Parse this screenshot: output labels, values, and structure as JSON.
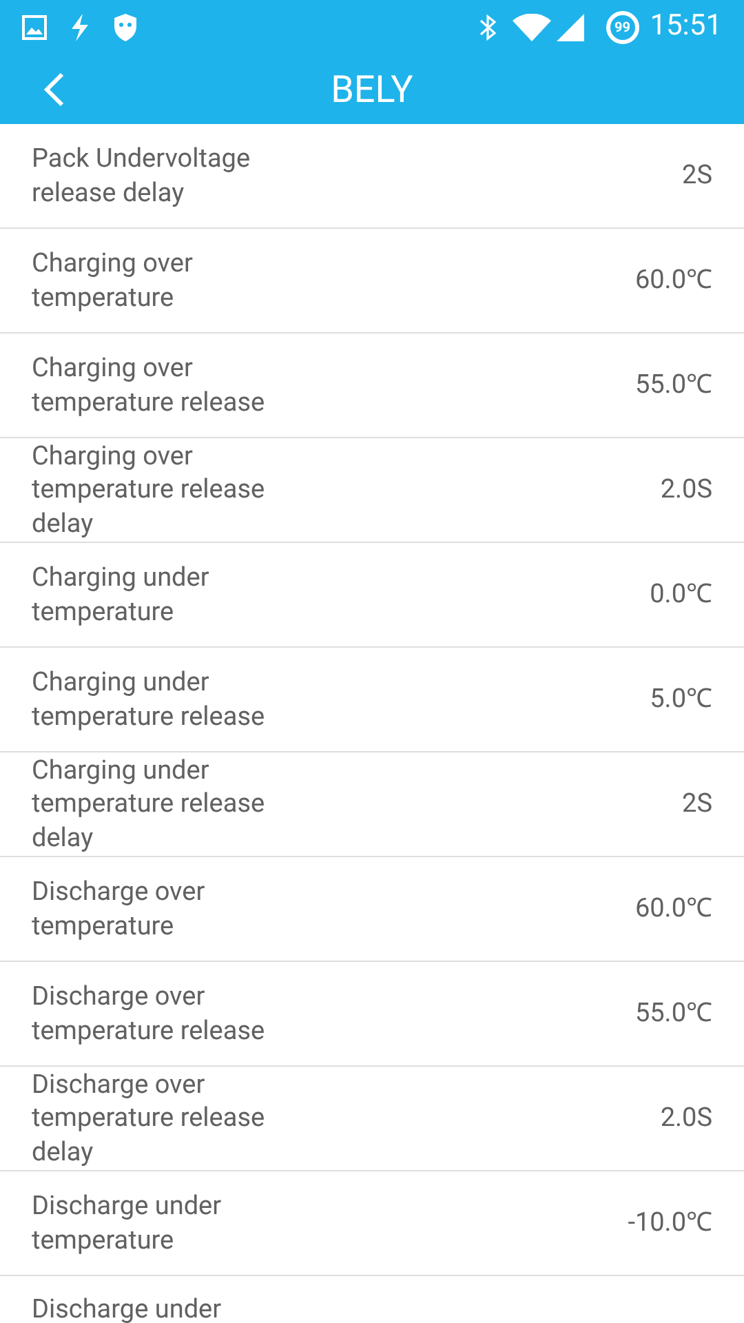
{
  "status_bar": {
    "time": "15:51",
    "badge": "99"
  },
  "app_bar": {
    "title": "BELY"
  },
  "rows": [
    {
      "label": "Pack Undervoltage release delay",
      "value": "2S"
    },
    {
      "label": "Charging over temperature",
      "value": "60.0℃"
    },
    {
      "label": "Charging over temperature release",
      "value": "55.0℃"
    },
    {
      "label": "Charging over temperature release delay",
      "value": "2.0S"
    },
    {
      "label": "Charging under temperature",
      "value": "0.0℃"
    },
    {
      "label": "Charging under temperature release",
      "value": "5.0℃"
    },
    {
      "label": "Charging under temperature release delay",
      "value": "2S"
    },
    {
      "label": "Discharge over temperature",
      "value": "60.0℃"
    },
    {
      "label": "Discharge over temperature release",
      "value": "55.0℃"
    },
    {
      "label": "Discharge over temperature release delay",
      "value": "2.0S"
    },
    {
      "label": "Discharge under temperature",
      "value": "-10.0℃"
    },
    {
      "label": "Discharge under"
    }
  ]
}
